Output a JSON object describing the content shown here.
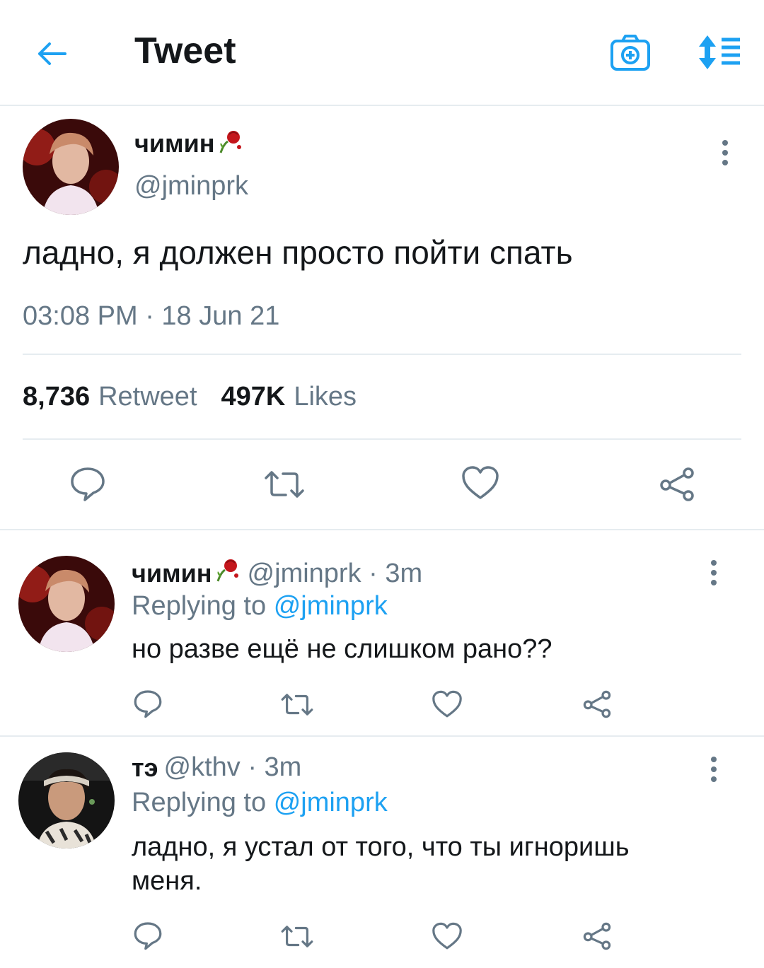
{
  "header": {
    "title": "Tweet",
    "accent_color": "#1da1f2"
  },
  "main_tweet": {
    "display_name": "чимин",
    "handle": "@jminprk",
    "text": "ладно, я должен просто пойти спать",
    "timestamp": "03:08 PM · 18 Jun 21",
    "retweet_count": "8,736",
    "retweet_label": "Retweet",
    "likes_count": "497K",
    "likes_label": "Likes"
  },
  "replies": [
    {
      "display_name": "чимин",
      "meta": "@jminprk · 3m",
      "replying_prefix": "Replying to",
      "replying_handle": "@jminprk",
      "text": "но разве ещё не слишком рано??"
    },
    {
      "display_name": "тэ",
      "meta": "@kthv · 3m",
      "replying_prefix": "Replying to",
      "replying_handle": "@jminprk",
      "text": "ладно, я устал от того, что ты игноришь меня."
    }
  ],
  "icons": {
    "back": "arrow-left-icon",
    "camera": "camera-plus-icon",
    "sort": "sort-arrows-icon",
    "more": "more-vertical-icon",
    "reply": "comment-icon",
    "retweet": "retweet-icon",
    "like": "heart-icon",
    "share": "share-icon",
    "rose": "wilted-rose-icon"
  }
}
